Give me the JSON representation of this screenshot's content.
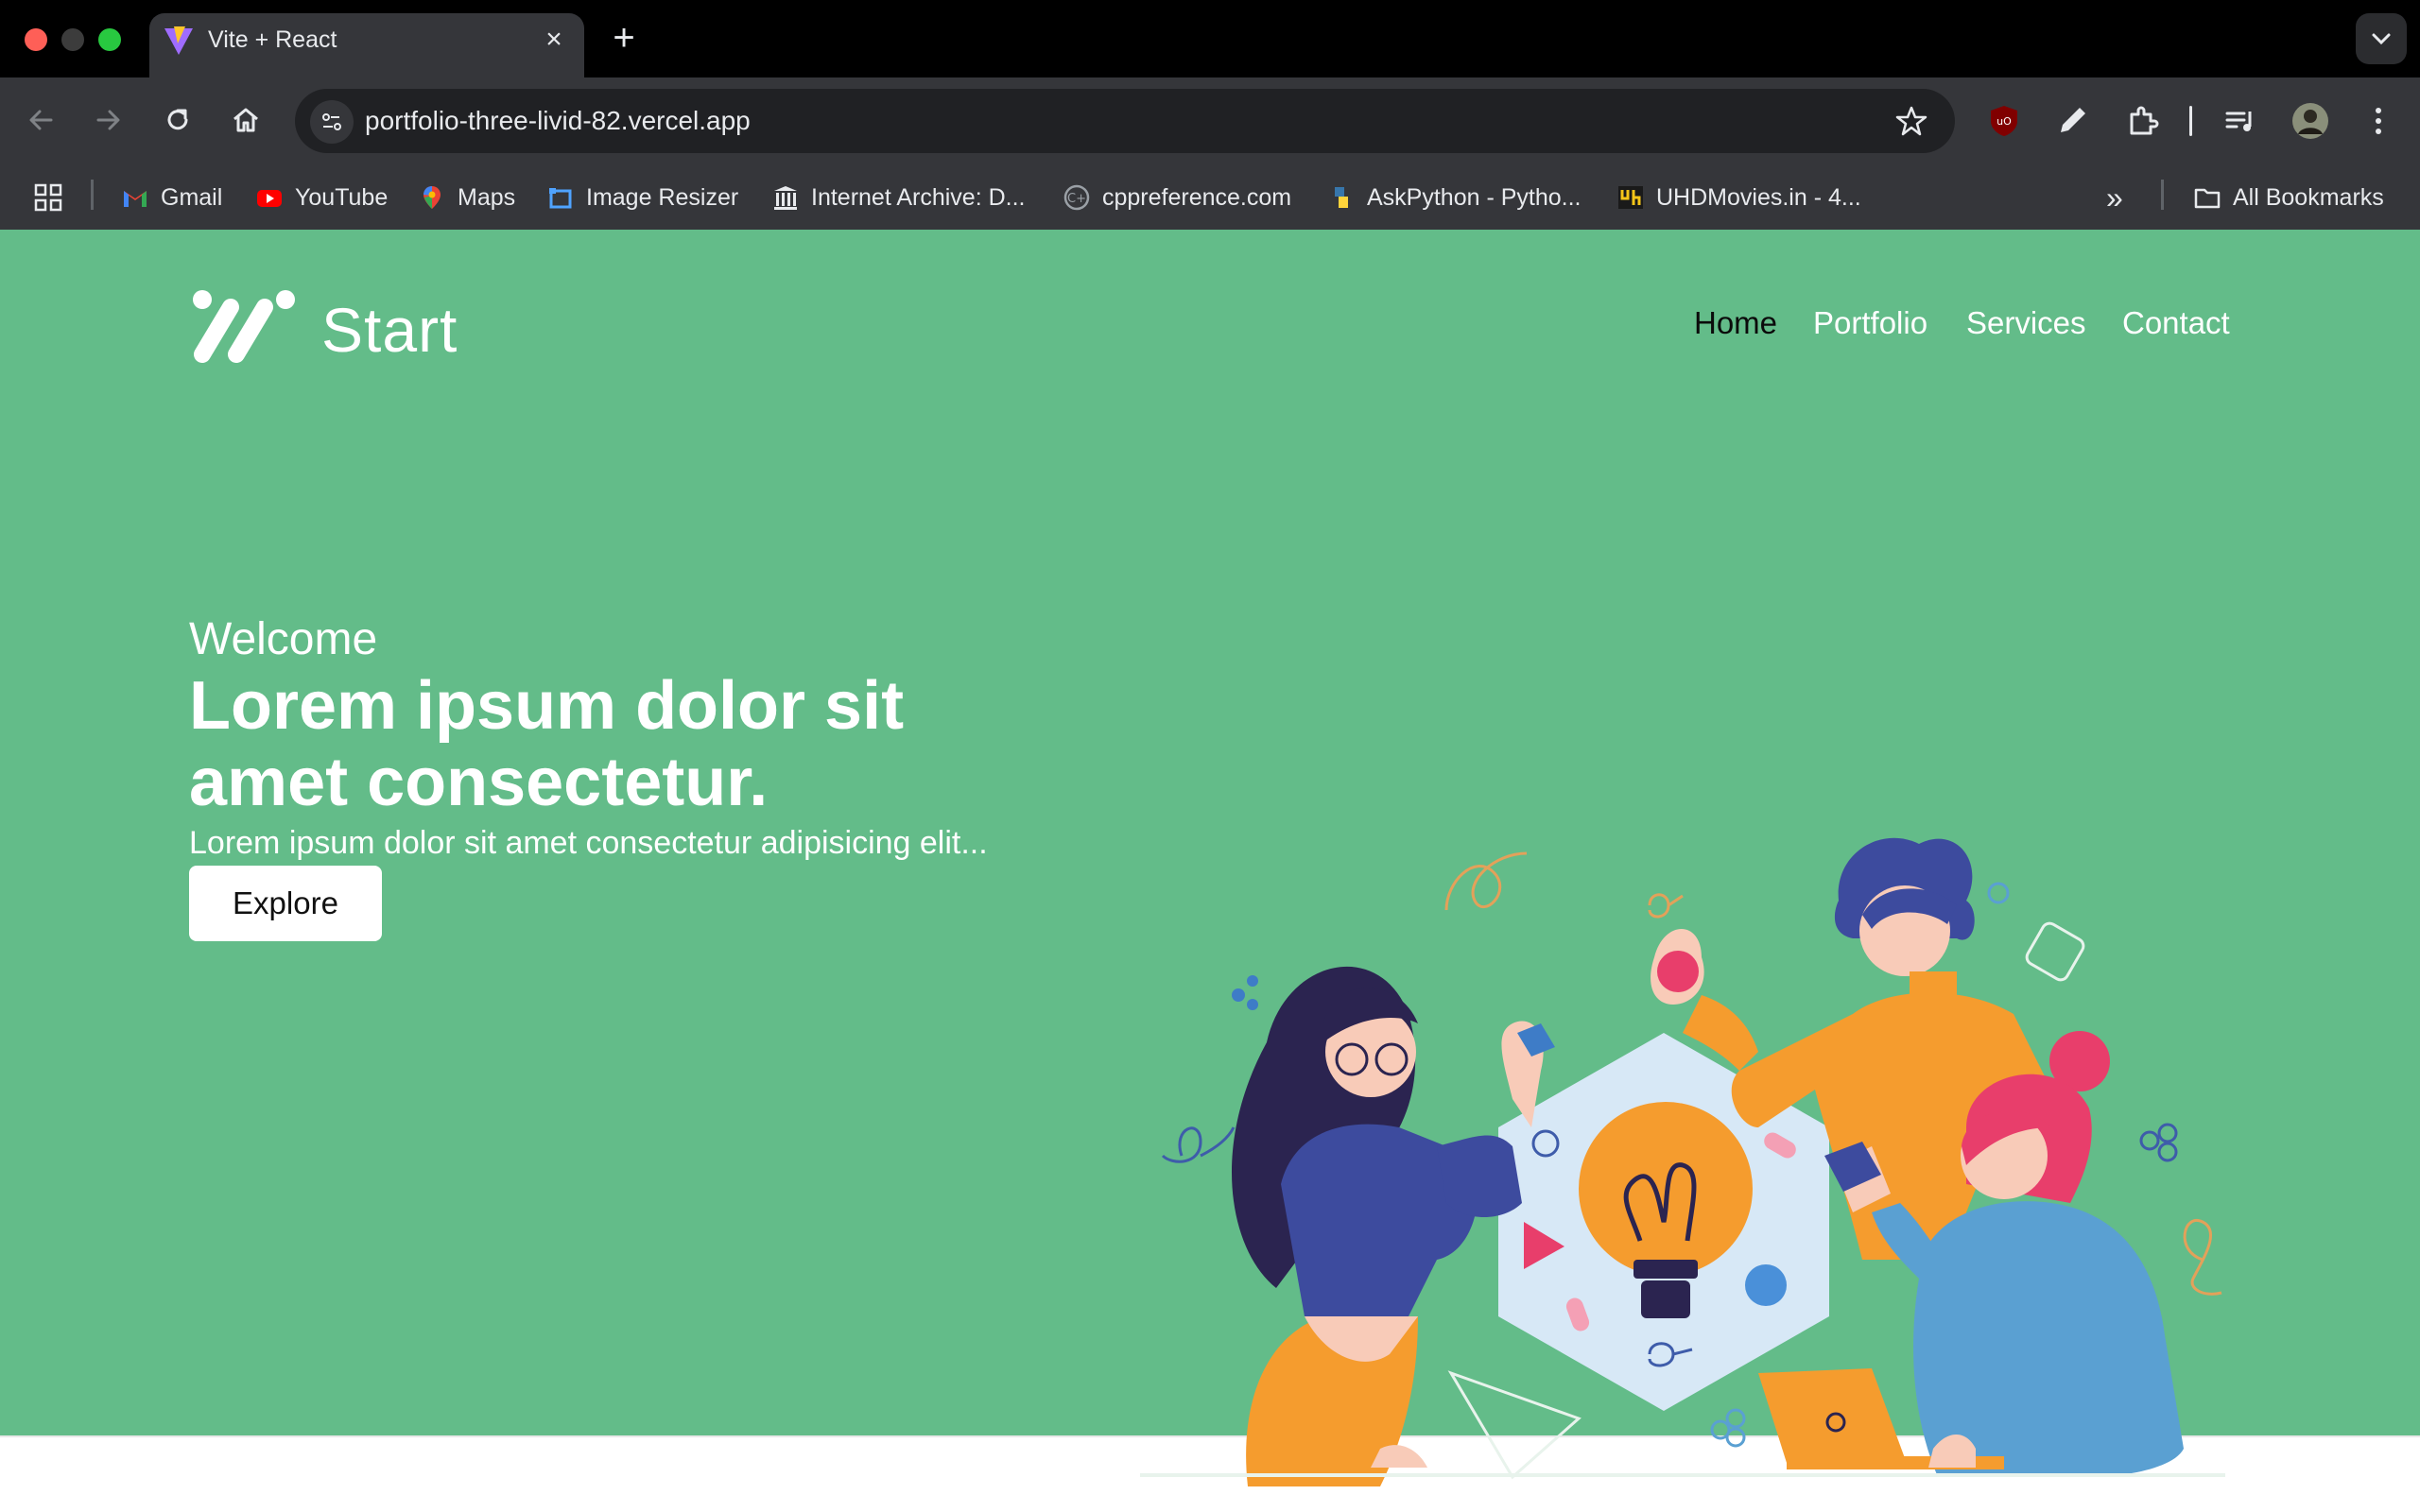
{
  "browser": {
    "tab_title": "Vite + React",
    "tab_close": "×",
    "new_tab": "+",
    "url": "portfolio-three-livid-82.vercel.app",
    "icons": [
      "back-icon",
      "forward-icon",
      "reload-icon",
      "home-icon",
      "site-info-icon",
      "bookmark-star-icon",
      "ublock-icon",
      "color-picker-icon",
      "extensions-icon",
      "media-controls-icon",
      "profile-avatar",
      "menu-icon"
    ],
    "bookmarks": [
      {
        "label": "Gmail",
        "icon": "gmail-icon"
      },
      {
        "label": "YouTube",
        "icon": "youtube-icon"
      },
      {
        "label": "Maps",
        "icon": "maps-icon"
      },
      {
        "label": "Image Resizer",
        "icon": "image-resizer-icon"
      },
      {
        "label": "Internet Archive: D...",
        "icon": "internet-archive-icon"
      },
      {
        "label": "cppreference.com",
        "icon": "cppreference-icon"
      },
      {
        "label": "AskPython - Pytho...",
        "icon": "askpython-icon"
      },
      {
        "label": "UHDMovies.in - 4...",
        "icon": "uhdmovies-icon"
      }
    ],
    "overflow": "»",
    "all_bookmarks": "All Bookmarks"
  },
  "page": {
    "brand": "Start",
    "nav": {
      "home": "Home",
      "portfolio": "Portfolio",
      "services": "Services",
      "contact": "Contact"
    },
    "hero": {
      "welcome": "Welcome",
      "headline": "Lorem ipsum dolor sit amet consectetur.",
      "subline": "Lorem ipsum dolor sit amet consectetur adipisicing elit...",
      "cta": "Explore"
    },
    "colors": {
      "hero_bg": "#63bc89",
      "active_nav": "#0b0b0b",
      "text": "#ffffff"
    }
  }
}
